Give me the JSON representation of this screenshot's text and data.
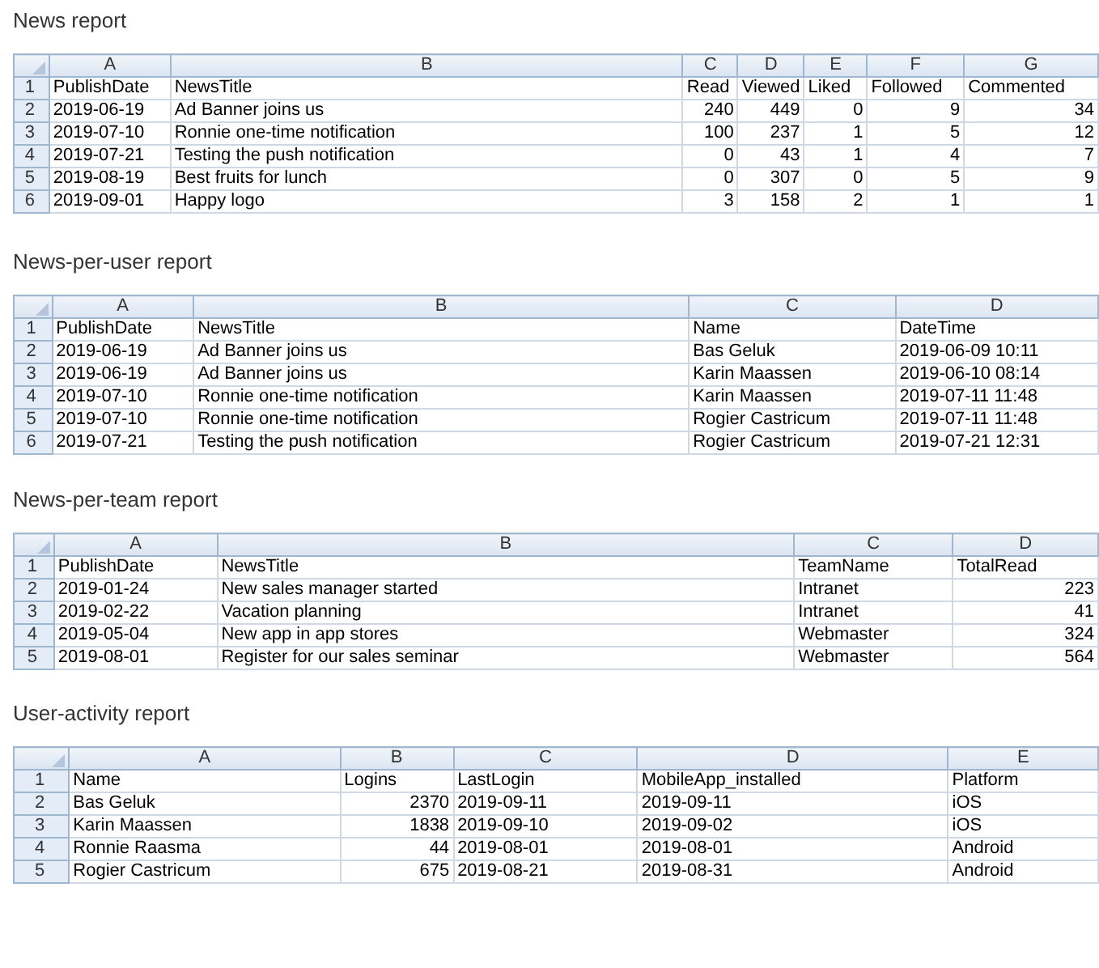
{
  "reports": [
    {
      "title": "News report",
      "columns": [
        {
          "letter": "A",
          "kind": "text"
        },
        {
          "letter": "B",
          "kind": "text"
        },
        {
          "letter": "C",
          "kind": "number"
        },
        {
          "letter": "D",
          "kind": "number"
        },
        {
          "letter": "E",
          "kind": "number"
        },
        {
          "letter": "F",
          "kind": "number"
        },
        {
          "letter": "G",
          "kind": "number"
        }
      ],
      "rows": [
        {
          "number": "1",
          "cells": [
            "PublishDate",
            "NewsTitle",
            "Read",
            "Viewed",
            "Liked",
            "Followed",
            "Commented"
          ]
        },
        {
          "number": "2",
          "cells": [
            "2019-06-19",
            "Ad Banner joins us",
            "240",
            "449",
            "0",
            "9",
            "34"
          ]
        },
        {
          "number": "3",
          "cells": [
            "2019-07-10",
            "Ronnie one-time notification",
            "100",
            "237",
            "1",
            "5",
            "12"
          ]
        },
        {
          "number": "4",
          "cells": [
            "2019-07-21",
            "Testing the push notification",
            "0",
            "43",
            "1",
            "4",
            "7"
          ]
        },
        {
          "number": "5",
          "cells": [
            "2019-08-19",
            "Best fruits for lunch",
            "0",
            "307",
            "0",
            "5",
            "9"
          ]
        },
        {
          "number": "6",
          "cells": [
            "2019-09-01",
            "Happy logo",
            "3",
            "158",
            "2",
            "1",
            "1"
          ]
        }
      ]
    },
    {
      "title": "News-per-user report",
      "columns": [
        {
          "letter": "A",
          "kind": "text"
        },
        {
          "letter": "B",
          "kind": "text"
        },
        {
          "letter": "C",
          "kind": "text"
        },
        {
          "letter": "D",
          "kind": "text"
        }
      ],
      "rows": [
        {
          "number": "1",
          "cells": [
            "PublishDate",
            "NewsTitle",
            "Name",
            "DateTime"
          ]
        },
        {
          "number": "2",
          "cells": [
            "2019-06-19",
            "Ad Banner joins us",
            "Bas Geluk",
            "2019-06-09 10:11"
          ]
        },
        {
          "number": "3",
          "cells": [
            "2019-06-19",
            "Ad Banner joins us",
            "Karin Maassen",
            "2019-06-10 08:14"
          ]
        },
        {
          "number": "4",
          "cells": [
            "2019-07-10",
            "Ronnie one-time notification",
            "Karin Maassen",
            "2019-07-11 11:48"
          ]
        },
        {
          "number": "5",
          "cells": [
            "2019-07-10",
            "Ronnie one-time notification",
            "Rogier Castricum",
            "2019-07-11 11:48"
          ]
        },
        {
          "number": "6",
          "cells": [
            "2019-07-21",
            "Testing the push notification",
            "Rogier Castricum",
            "2019-07-21 12:31"
          ]
        }
      ]
    },
    {
      "title": "News-per-team report",
      "columns": [
        {
          "letter": "A",
          "kind": "text"
        },
        {
          "letter": "B",
          "kind": "text"
        },
        {
          "letter": "C",
          "kind": "text"
        },
        {
          "letter": "D",
          "kind": "number"
        }
      ],
      "rows": [
        {
          "number": "1",
          "cells": [
            "PublishDate",
            "NewsTitle",
            "TeamName",
            "TotalRead"
          ]
        },
        {
          "number": "2",
          "cells": [
            "2019-01-24",
            "New sales manager started",
            "Intranet",
            "223"
          ]
        },
        {
          "number": "3",
          "cells": [
            "2019-02-22",
            "Vacation planning",
            "Intranet",
            "41"
          ]
        },
        {
          "number": "4",
          "cells": [
            "2019-05-04",
            "New app in app stores",
            "Webmaster",
            "324"
          ]
        },
        {
          "number": "5",
          "cells": [
            "2019-08-01",
            "Register for our sales seminar",
            "Webmaster",
            "564"
          ]
        }
      ]
    },
    {
      "title": "User-activity report",
      "columns": [
        {
          "letter": "A",
          "kind": "text"
        },
        {
          "letter": "B",
          "kind": "number"
        },
        {
          "letter": "C",
          "kind": "text"
        },
        {
          "letter": "D",
          "kind": "text"
        },
        {
          "letter": "E",
          "kind": "text"
        }
      ],
      "rows": [
        {
          "number": "1",
          "cells": [
            "Name",
            "Logins",
            "LastLogin",
            "MobileApp_installed",
            "Platform"
          ]
        },
        {
          "number": "2",
          "cells": [
            "Bas Geluk",
            "2370",
            "2019-09-11",
            "2019-09-11",
            "iOS"
          ]
        },
        {
          "number": "3",
          "cells": [
            "Karin Maassen",
            "1838",
            "2019-09-10",
            "2019-09-02",
            "iOS"
          ]
        },
        {
          "number": "4",
          "cells": [
            "Ronnie Raasma",
            "44",
            "2019-08-01",
            "2019-08-01",
            "Android"
          ]
        },
        {
          "number": "5",
          "cells": [
            "Rogier Castricum",
            "675",
            "2019-08-21",
            "2019-08-31",
            "Android"
          ]
        }
      ]
    }
  ]
}
